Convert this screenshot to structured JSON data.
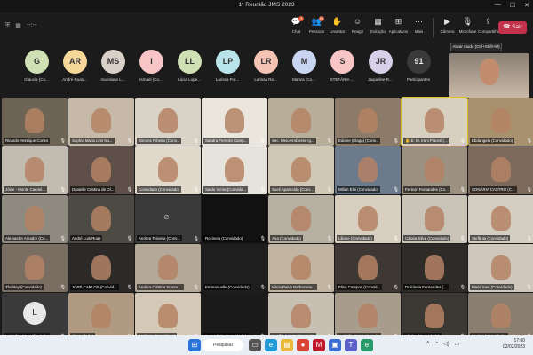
{
  "window": {
    "title": "1ª Reunião JMS 2023"
  },
  "toolbar": {
    "left_status": "--:--",
    "items": [
      {
        "icon": "chat-icon",
        "glyph": "💬",
        "label": "Chat",
        "badge": "3"
      },
      {
        "icon": "people-icon",
        "glyph": "👥",
        "label": "Pessoas",
        "badge": "95"
      },
      {
        "icon": "raise-hand-icon",
        "glyph": "✋",
        "label": "Levantar",
        "badge": ""
      },
      {
        "icon": "react-icon",
        "glyph": "☺",
        "label": "Reagir",
        "badge": ""
      },
      {
        "icon": "view-icon",
        "glyph": "▦",
        "label": "Exibição",
        "badge": ""
      },
      {
        "icon": "apps-icon",
        "glyph": "⊞",
        "label": "Aplicativos",
        "badge": ""
      },
      {
        "icon": "more-icon",
        "glyph": "⋯",
        "label": "Mais",
        "badge": ""
      }
    ],
    "av_items": [
      {
        "icon": "camera-icon",
        "glyph": "▶",
        "label": "Câmera"
      },
      {
        "icon": "microphone-icon",
        "glyph": "🎙",
        "label": "Microfone"
      },
      {
        "icon": "share-icon",
        "glyph": "⇪",
        "label": "Compartilhar"
      }
    ],
    "leave_label": "Sair"
  },
  "tooltip": "Ativar mudo (Ctrl+Shift+M)",
  "avatars": [
    {
      "initials": "G",
      "name": "Glaucia (Co...",
      "color": "#cfe0b4"
    },
    {
      "initials": "AR",
      "name": "André Ruas...",
      "color": "#f6d79a"
    },
    {
      "initials": "MS",
      "name": "marislane L...",
      "color": "#d9d0c8"
    },
    {
      "initials": "I",
      "name": "Ismael (Co...",
      "color": "#f7c5c5"
    },
    {
      "initials": "LL",
      "name": "Lúcia Lope...",
      "color": "#cfe0b4"
    },
    {
      "initials": "LP",
      "name": "Larissa Pot...",
      "color": "#b8e4ea"
    },
    {
      "initials": "LR",
      "name": "Larissa Ra...",
      "color": "#f4c3b3"
    },
    {
      "initials": "M",
      "name": "Manza (Co...",
      "color": "#c8d4f0"
    },
    {
      "initials": "S",
      "name": "STEFÂNIA ...",
      "color": "#f7c5c5"
    },
    {
      "initials": "JR",
      "name": "Jaqueline R...",
      "color": "#d8cfe8"
    },
    {
      "initials": "91",
      "name": "Participantes",
      "color": "#3a3a3a"
    }
  ],
  "participants": [
    {
      "name": "Ricardo Henrique Cortes",
      "bg": "#6d6455"
    },
    {
      "name": "Sophia Maria Lins Nu...",
      "bg": "#c7b9a8"
    },
    {
      "name": "Simone Ribeiro (Conv...",
      "bg": "#d9d2c6"
    },
    {
      "name": "Sandra Ferreira Camp...",
      "bg": "#ebe6dd"
    },
    {
      "name": "Sec. Meio Ambiente Ig...",
      "bg": "#b8ad98"
    },
    {
      "name": "Ediane (Elaga) (Conv...",
      "bg": "#8c7b68"
    },
    {
      "name": "E. M. Irani Piaceri (...",
      "bg": "#d7d0c0",
      "active": true,
      "hand": true
    },
    {
      "name": "Ebdangela (Convidado)",
      "bg": "#a8916e"
    },
    {
      "name": "Jôice - Monte Camiel...",
      "bg": "#c2bbb0"
    },
    {
      "name": "Danielle Cristina de Ol...",
      "bg": "#5e5048"
    },
    {
      "name": "Convidado (Convidado)",
      "bg": "#e0d9cc"
    },
    {
      "name": "Saulo Vieira (Convida...",
      "bg": "#e6e2dc"
    },
    {
      "name": "Sueli Aparecida (Conv...",
      "bg": "#d0c7b5"
    },
    {
      "name": "Milian Eloi (Convidado)",
      "bg": "#6d7a8c"
    },
    {
      "name": "Ferison Fernandes (Co...",
      "bg": "#9c9080"
    },
    {
      "name": "SONÁRIA CASTRO (C...",
      "bg": "#7c6a5c"
    },
    {
      "name": "Alexandre Amador (Co...",
      "bg": "#8f8a80"
    },
    {
      "name": "André Luis Ruas",
      "bg": "#4d4a44"
    },
    {
      "name": "Andrea Teixeira (Conv...",
      "bg": "#3a3a3a",
      "no_camera": true
    },
    {
      "name": "Rozineia (Convidado)",
      "bg": "#111111"
    },
    {
      "name": "Ana (Convidado)",
      "bg": "#b6b0a2"
    },
    {
      "name": "Liliane (Convidado)",
      "bg": "#d8cfc0"
    },
    {
      "name": "Cássia Silva (Convidado)",
      "bg": "#c9c3b8"
    },
    {
      "name": "Stefânia (Convidado)",
      "bg": "#d4cdc2"
    },
    {
      "name": "Thaírley (Convidado)",
      "bg": "#7a6e62"
    },
    {
      "name": "JOSÉ CARLOS (Convid...",
      "bg": "#2c2a28"
    },
    {
      "name": "Andrea Cristina Sousa ...",
      "bg": "#b4a998"
    },
    {
      "name": "Emmanuelle (Convidado)",
      "bg": "#1e1e1e"
    },
    {
      "name": "Nilcia Paiva Barbacena...",
      "bg": "#c1b5a2"
    },
    {
      "name": "Elisa Campos (Convid...",
      "bg": "#3d3833"
    },
    {
      "name": "Dulcineia Fernandes (...",
      "bg": "#2e2b28"
    },
    {
      "name": "Maria Ines (Convidado)",
      "bg": "#cfc7bb"
    },
    {
      "name": "Lucinda - EM João Gui...",
      "bg": "#3a3a3a",
      "initial": "L"
    },
    {
      "name": "(Convidado)",
      "bg": "#b09a82"
    },
    {
      "name": "Jesilene (Convidado)",
      "bg": "#d4c8b6"
    },
    {
      "name": "Convidado (Convidado)",
      "bg": "#1a1a1a"
    },
    {
      "name": "Cecília Fausto (Convid...",
      "bg": "#c7bfb2"
    },
    {
      "name": "Danielle Braga (Convi...",
      "bg": "#a89c8c"
    },
    {
      "name": "Shirley (Convidado)",
      "bg": "#3c3834"
    },
    {
      "name": "Marina (Convidado)",
      "bg": "#8a7e70"
    }
  ],
  "taskbar": {
    "search_label": "Pesquisar",
    "time": "17:00",
    "date": "02/02/2023"
  }
}
